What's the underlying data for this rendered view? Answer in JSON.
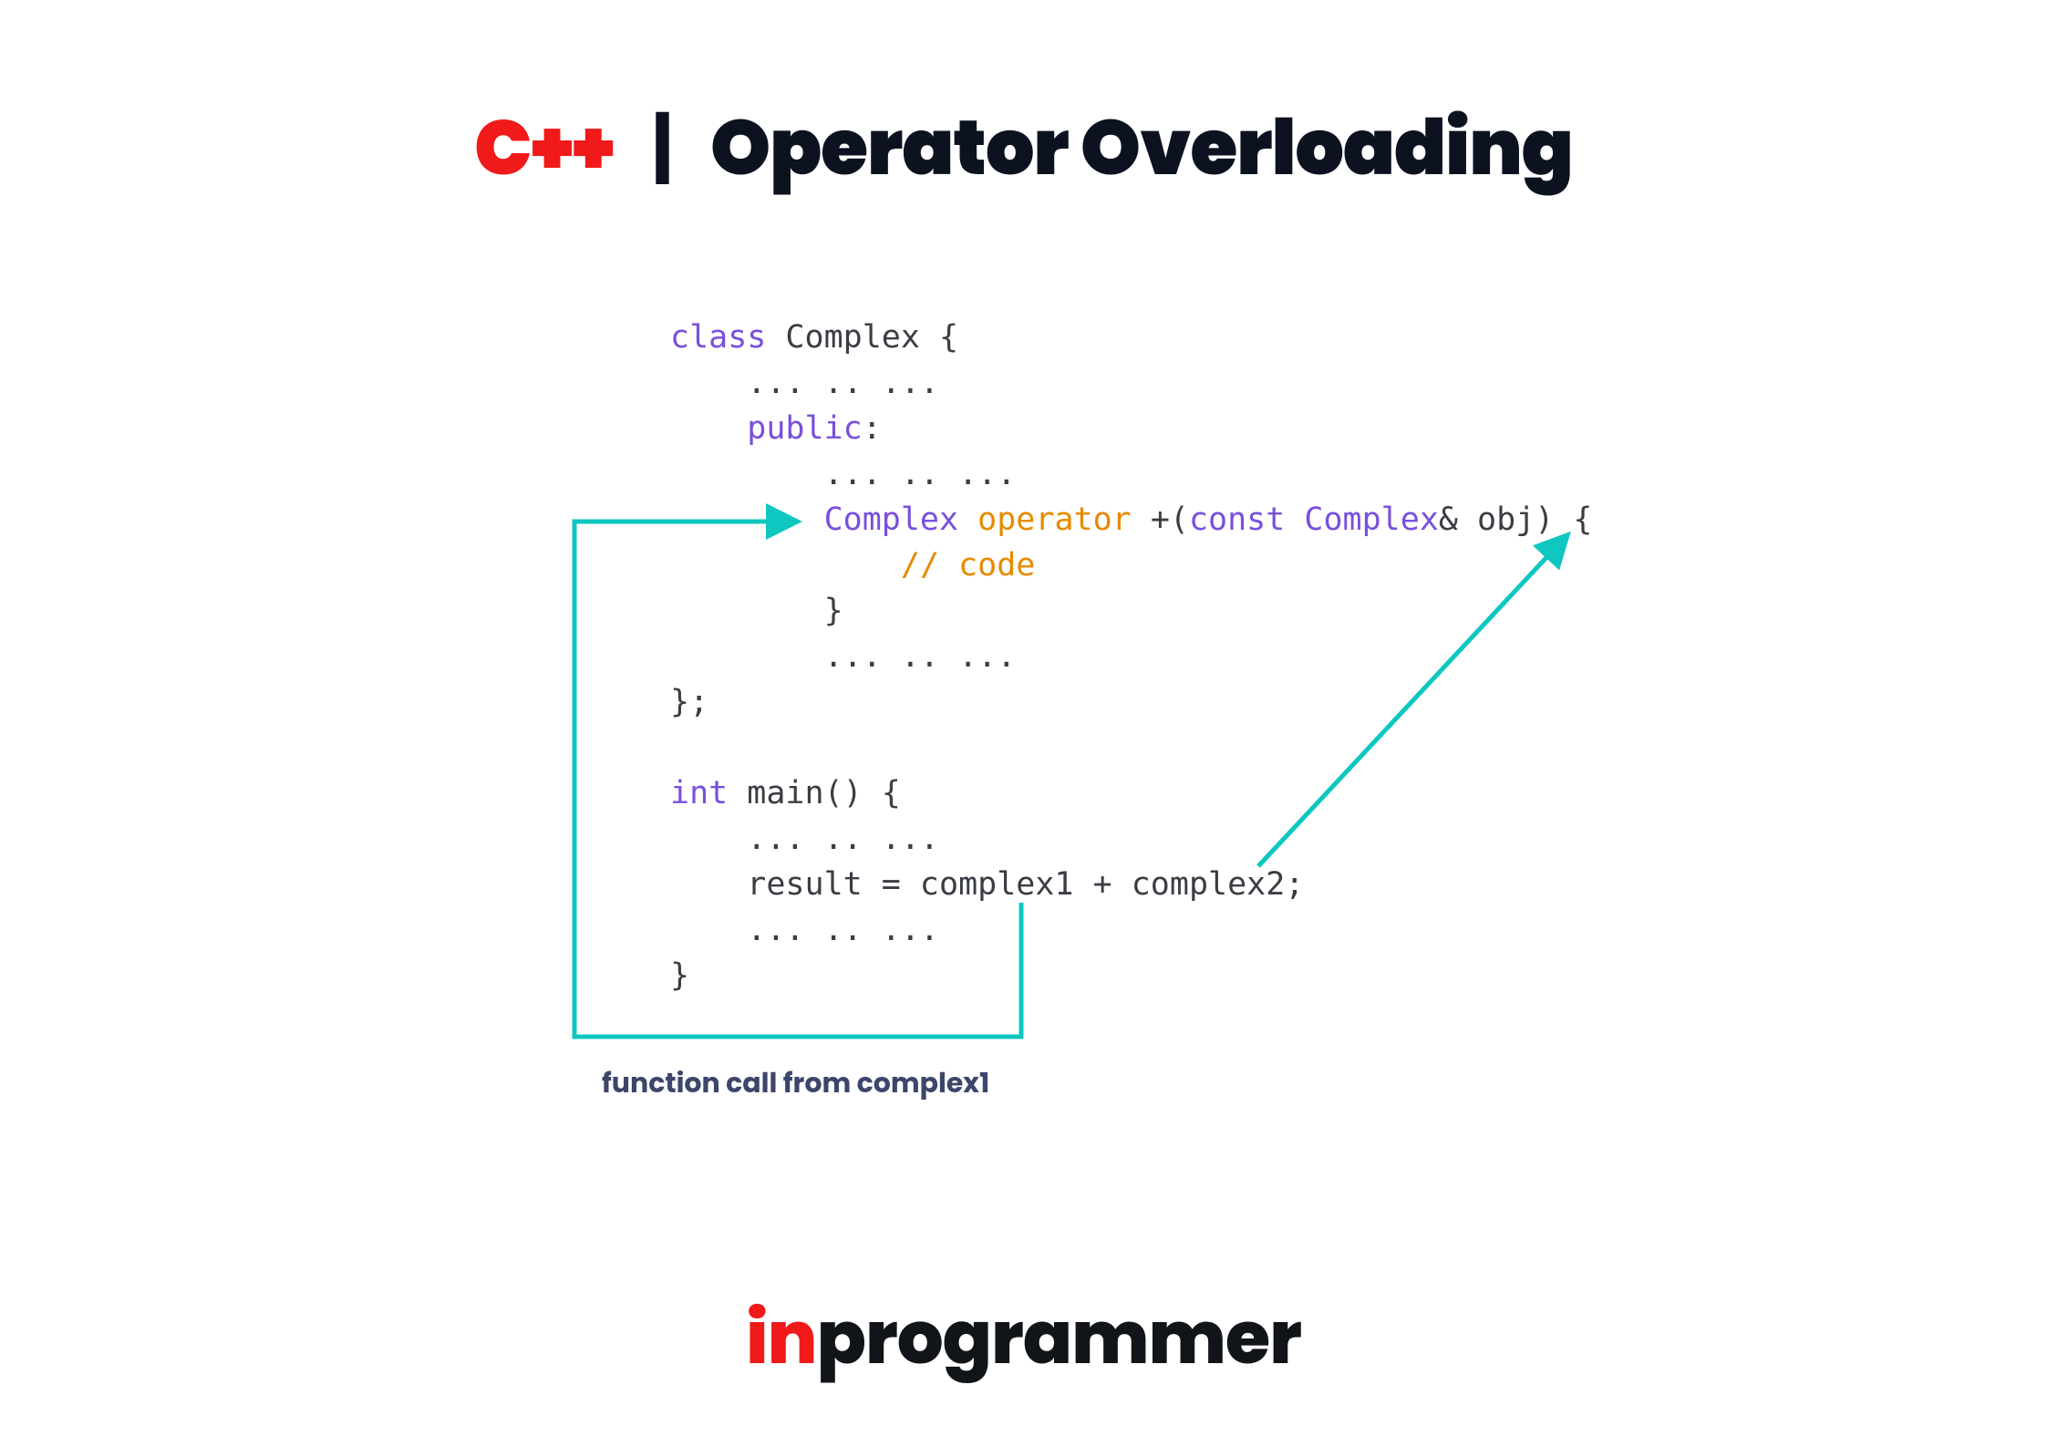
{
  "title": {
    "cpp": "C++",
    "sep": "|",
    "main": "Operator Overloading"
  },
  "code": {
    "l1_kw": "class",
    "l1_name": " Complex {",
    "l2": "    ... .. ...",
    "l3": "    public",
    "l3_colon": ":",
    "l4": "        ... .. ...",
    "l5_ind": "        ",
    "l5_type": "Complex ",
    "l5_op": "operator ",
    "l5_plus": "+(",
    "l5_const": "const",
    "l5_ctype": " Complex",
    "l5_amp": "& obj) {",
    "l6_ind": "            ",
    "l6_cmt": "// code",
    "l7": "        }",
    "l8": "        ... .. ...",
    "l9": "};",
    "l10": "",
    "l11_type": "int",
    "l11_rest": " main() {",
    "l12": "    ... .. ...",
    "l13": "    result = complex1 + complex2;",
    "l14": "    ... .. ...",
    "l15": "}"
  },
  "annotation": "function call from complex1",
  "brand": {
    "in": "in",
    "rest": "programmer"
  },
  "accent": {
    "teal": "#0ec7c0",
    "red": "#f01a1a",
    "purple": "#7a4fdc",
    "orange": "#e68a00",
    "annot": "#3d466a"
  }
}
